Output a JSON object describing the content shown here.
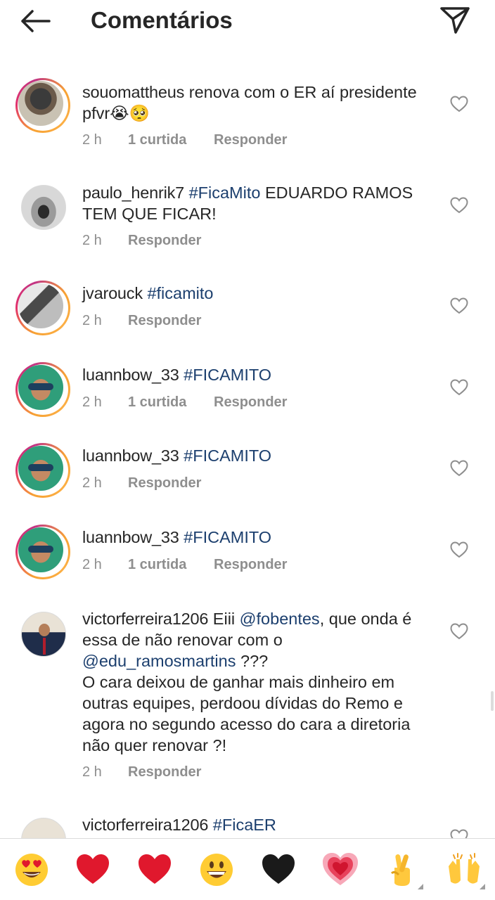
{
  "header": {
    "title": "Comentários",
    "back_icon": "arrow-left-icon",
    "send_icon": "paper-plane-icon"
  },
  "comments": [
    {
      "username": "souomattheus",
      "text": " renova com o ER aí presidente pfvr😭🥺",
      "time": "2 h",
      "likes": "1 curtida",
      "reply": "Responder",
      "story_ring": true
    },
    {
      "username": "paulo_henrik7",
      "hashtag": "#FicaMito",
      "text": " EDUARDO RAMOS TEM QUE FICAR!",
      "time": "2 h",
      "reply": "Responder",
      "story_ring": false
    },
    {
      "username": "jvarouck",
      "hashtag": "#ficamito",
      "time": "2 h",
      "reply": "Responder",
      "story_ring": true
    },
    {
      "username": "luannbow_33",
      "hashtag": "#FICAMITO",
      "time": "2 h",
      "likes": "1 curtida",
      "reply": "Responder",
      "story_ring": true
    },
    {
      "username": "luannbow_33",
      "hashtag": "#FICAMITO",
      "time": "2 h",
      "reply": "Responder",
      "story_ring": true
    },
    {
      "username": "luannbow_33",
      "hashtag": "#FICAMITO",
      "time": "2 h",
      "likes": "1 curtida",
      "reply": "Responder",
      "story_ring": true
    },
    {
      "username": "victorferreira1206",
      "text_a": " Eiii ",
      "mention_1": "@fobentes",
      "text_b": ", que onda é essa de não renovar com o ",
      "mention_2": "@edu_ramosmartins",
      "text_c": " ???",
      "text_d": "O cara deixou de ganhar mais dinheiro em outras equipes, perdoou dívidas do Remo e agora no segundo acesso do cara a diretoria não quer renovar ?!",
      "time": "2 h",
      "reply": "Responder",
      "story_ring": false
    },
    {
      "username": "victorferreira1206",
      "hashtag": "#FicaER",
      "story_ring": false
    }
  ],
  "emoji_bar": {
    "items": [
      "heart-eyes-emoji",
      "red-heart-emoji",
      "red-heart-emoji",
      "grinning-face-emoji",
      "black-heart-emoji",
      "growing-heart-emoji",
      "crossed-fingers-emoji",
      "raising-hands-emoji"
    ]
  },
  "colors": {
    "text": "#262626",
    "secondary": "#8e8e8e",
    "hashtag": "#1c3f6e",
    "heart_red": "#e0182d"
  }
}
